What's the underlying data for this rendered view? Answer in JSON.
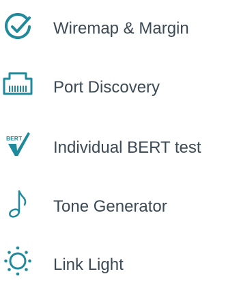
{
  "colors": {
    "accent": "#1f8a9c",
    "text": "#3c4a55",
    "background": "#ffffff"
  },
  "menu": {
    "items": [
      {
        "label": "Wiremap & Margin",
        "icon": "checkmark-circle-icon"
      },
      {
        "label": "Port Discovery",
        "icon": "ethernet-port-icon"
      },
      {
        "label": "Individual BERT test",
        "icon": "bert-check-icon",
        "icon_text": "BERT"
      },
      {
        "label": "Tone Generator",
        "icon": "music-note-icon"
      },
      {
        "label": "Link Light",
        "icon": "light-sun-icon"
      }
    ]
  }
}
